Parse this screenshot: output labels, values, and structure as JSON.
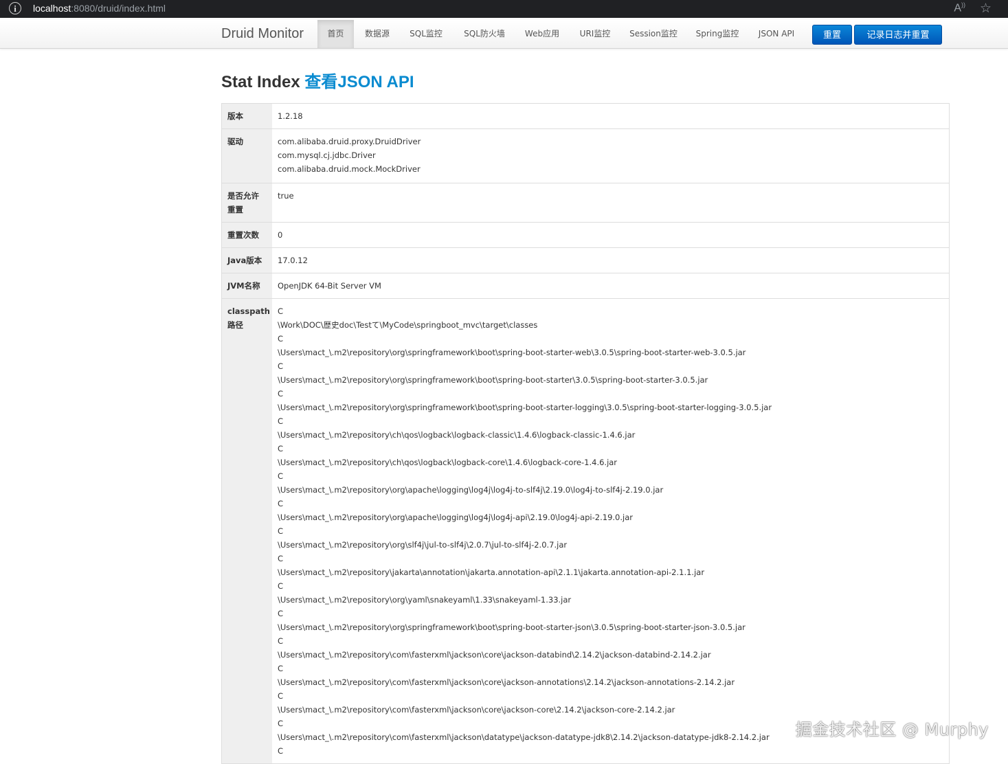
{
  "browser": {
    "url_host": "localhost",
    "url_rest": ":8080/druid/index.html",
    "info_icon": "info-icon",
    "read_aloud_icon": "A",
    "favorite_icon": "☆"
  },
  "navbar": {
    "brand": "Druid Monitor",
    "items": [
      {
        "label": "首页",
        "active": true
      },
      {
        "label": "数据源"
      },
      {
        "label": "SQL监控"
      },
      {
        "label": "SQL防火墙"
      },
      {
        "label": "Web应用"
      },
      {
        "label": "URI监控"
      },
      {
        "label": "Session监控"
      },
      {
        "label": "Spring监控"
      },
      {
        "label": "JSON API"
      }
    ],
    "reset_button": "重置",
    "log_reset_button": "记录日志并重置",
    "button_color": "#0067c6"
  },
  "heading": {
    "title": "Stat Index",
    "json_link": "查看JSON API"
  },
  "table": {
    "version": {
      "label": "版本",
      "value": "1.2.18"
    },
    "driver": {
      "label": "驱动",
      "values": [
        "com.alibaba.druid.proxy.DruidDriver",
        "com.mysql.cj.jdbc.Driver",
        "com.alibaba.druid.mock.MockDriver"
      ]
    },
    "reset_enable": {
      "label": "是否允许重置",
      "value": "true"
    },
    "reset_count": {
      "label": "重置次数",
      "value": "0"
    },
    "java_version": {
      "label": "Java版本",
      "value": "17.0.12"
    },
    "jvm_name": {
      "label": "JVM名称",
      "value": "OpenJDK 64-Bit Server VM"
    },
    "classpath": {
      "label": "classpath路径",
      "lines": [
        "C",
        "\\Work\\DOC\\歴史doc\\Testて\\MyCode\\springboot_mvc\\target\\classes",
        "C",
        "\\Users\\mact_\\.m2\\repository\\org\\springframework\\boot\\spring-boot-starter-web\\3.0.5\\spring-boot-starter-web-3.0.5.jar",
        "C",
        "\\Users\\mact_\\.m2\\repository\\org\\springframework\\boot\\spring-boot-starter\\3.0.5\\spring-boot-starter-3.0.5.jar",
        "C",
        "\\Users\\mact_\\.m2\\repository\\org\\springframework\\boot\\spring-boot-starter-logging\\3.0.5\\spring-boot-starter-logging-3.0.5.jar",
        "C",
        "\\Users\\mact_\\.m2\\repository\\ch\\qos\\logback\\logback-classic\\1.4.6\\logback-classic-1.4.6.jar",
        "C",
        "\\Users\\mact_\\.m2\\repository\\ch\\qos\\logback\\logback-core\\1.4.6\\logback-core-1.4.6.jar",
        "C",
        "\\Users\\mact_\\.m2\\repository\\org\\apache\\logging\\log4j\\log4j-to-slf4j\\2.19.0\\log4j-to-slf4j-2.19.0.jar",
        "C",
        "\\Users\\mact_\\.m2\\repository\\org\\apache\\logging\\log4j\\log4j-api\\2.19.0\\log4j-api-2.19.0.jar",
        "C",
        "\\Users\\mact_\\.m2\\repository\\org\\slf4j\\jul-to-slf4j\\2.0.7\\jul-to-slf4j-2.0.7.jar",
        "C",
        "\\Users\\mact_\\.m2\\repository\\jakarta\\annotation\\jakarta.annotation-api\\2.1.1\\jakarta.annotation-api-2.1.1.jar",
        "C",
        "\\Users\\mact_\\.m2\\repository\\org\\yaml\\snakeyaml\\1.33\\snakeyaml-1.33.jar",
        "C",
        "\\Users\\mact_\\.m2\\repository\\org\\springframework\\boot\\spring-boot-starter-json\\3.0.5\\spring-boot-starter-json-3.0.5.jar",
        "C",
        "\\Users\\mact_\\.m2\\repository\\com\\fasterxml\\jackson\\core\\jackson-databind\\2.14.2\\jackson-databind-2.14.2.jar",
        "C",
        "\\Users\\mact_\\.m2\\repository\\com\\fasterxml\\jackson\\core\\jackson-annotations\\2.14.2\\jackson-annotations-2.14.2.jar",
        "C",
        "\\Users\\mact_\\.m2\\repository\\com\\fasterxml\\jackson\\core\\jackson-core\\2.14.2\\jackson-core-2.14.2.jar",
        "C",
        "\\Users\\mact_\\.m2\\repository\\com\\fasterxml\\jackson\\datatype\\jackson-datatype-jdk8\\2.14.2\\jackson-datatype-jdk8-2.14.2.jar",
        "C"
      ]
    }
  },
  "watermark": "掘金技术社区 @ Murphy"
}
